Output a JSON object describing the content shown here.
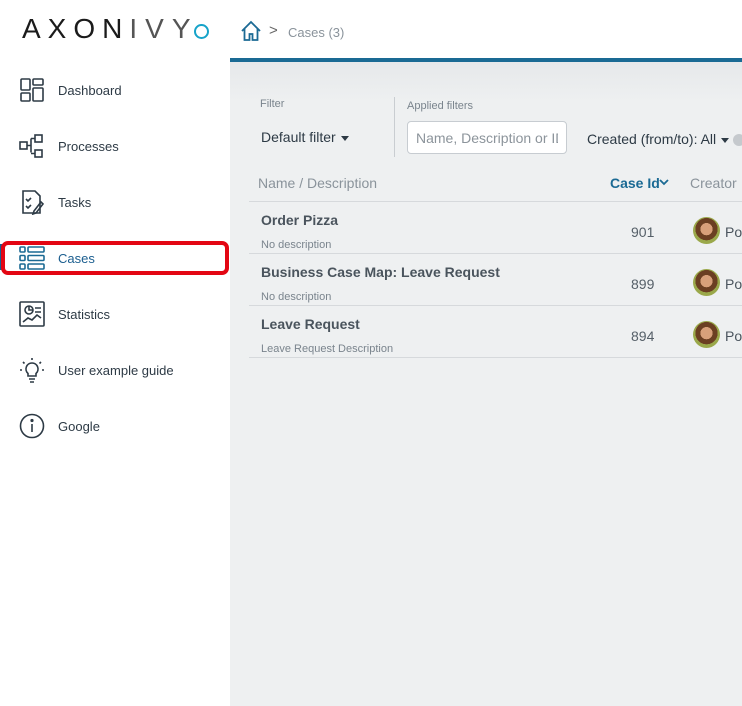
{
  "app": {
    "logo_text": "AXON",
    "logo_text_thin": "IVY"
  },
  "sidebar": {
    "items": [
      {
        "label": "Dashboard",
        "icon": "dashboard-icon"
      },
      {
        "label": "Processes",
        "icon": "processes-icon"
      },
      {
        "label": "Tasks",
        "icon": "tasks-icon"
      },
      {
        "label": "Cases",
        "icon": "cases-icon",
        "active": true
      },
      {
        "label": "Statistics",
        "icon": "statistics-icon"
      },
      {
        "label": "User example guide",
        "icon": "lightbulb-icon"
      },
      {
        "label": "Google",
        "icon": "info-icon"
      }
    ]
  },
  "breadcrumb": {
    "home_icon": "home-icon",
    "separator": ">",
    "current": "Cases (3)"
  },
  "filters": {
    "filter_label": "Filter",
    "filter_value": "Default filter",
    "applied_label": "Applied filters",
    "search_placeholder": "Name, Description or ID",
    "created_filter": "Created (from/to): All"
  },
  "table": {
    "columns": {
      "name": "Name / Description",
      "id": "Case Id",
      "creator": "Creator"
    },
    "rows": [
      {
        "title": "Order Pizza",
        "description": "No description",
        "id": "901",
        "creator": "Po"
      },
      {
        "title": "Business Case Map: Leave Request",
        "description": "No description",
        "id": "899",
        "creator": "Po"
      },
      {
        "title": "Leave Request",
        "description": "Leave Request Description",
        "id": "894",
        "creator": "Po"
      }
    ]
  },
  "colors": {
    "accent": "#1a6a94",
    "logo_circle": "#16a3c9",
    "highlight": "#e30613"
  }
}
